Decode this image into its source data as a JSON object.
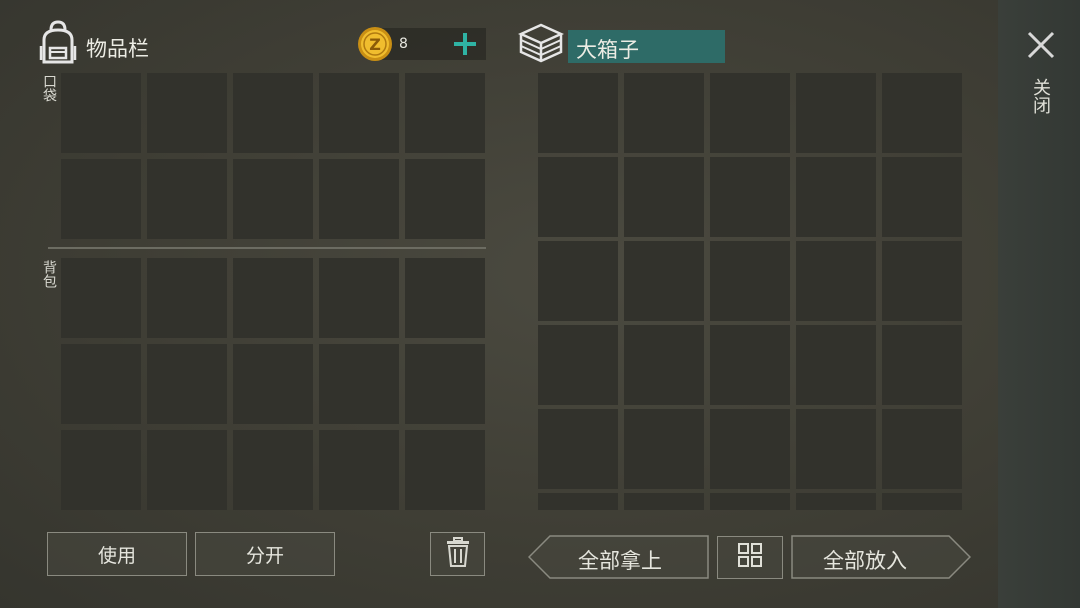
{
  "inventory": {
    "title": "物品栏",
    "pocket_label": "口袋",
    "backpack_label": "背包",
    "coin_count": "8",
    "use_button": "使用",
    "split_button": "分开"
  },
  "container": {
    "name": "大箱子",
    "take_all_button": "全部拿上",
    "put_all_button": "全部放入"
  },
  "close_label": "关闭",
  "colors": {
    "accent_plus": "#2fb3a4",
    "name_bar": "#2e6b67",
    "coin_gold": "#e0a820"
  },
  "icons": {
    "backpack": "backpack-icon",
    "coin": "coin-icon",
    "add": "plus-icon",
    "container": "stacked-boxes-icon",
    "trash": "trash-icon",
    "grid": "grid-icon",
    "close": "close-icon"
  }
}
